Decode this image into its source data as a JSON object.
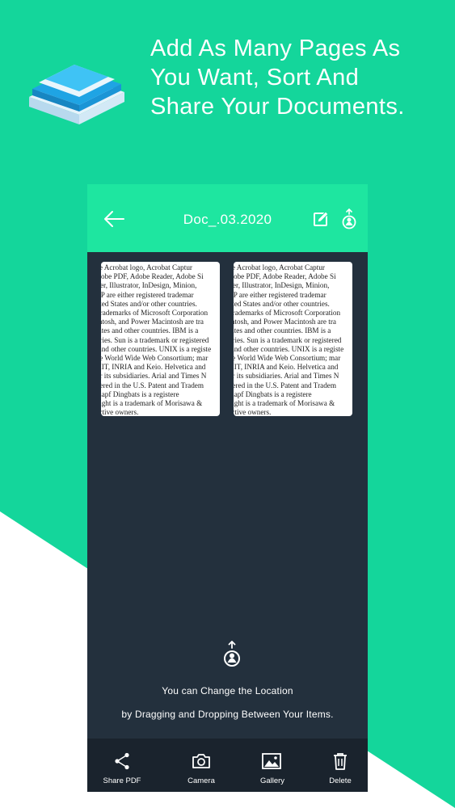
{
  "promo": {
    "headline_lines": [
      "Add As Many Pages As",
      "You Want, Sort And",
      "Share Your Documents."
    ]
  },
  "app_bar": {
    "title": "Doc_.03.2020"
  },
  "pages": [
    {
      "lines": [
        "gs, the Acrobat logo, Acrobat Captur",
        "el, Adobe PDF, Adobe Reader, Adobe Si",
        "eMaker, Illustrator, InDesign, Minion,",
        "d XMP are either registered trademar",
        "e United States and/or other countries.",
        "ered trademarks of Microsoft Corporation",
        "Macintosh, and Power Macintosh are tra",
        "ed States and other countries. IBM is a",
        "countries. Sun is a trademark or registered",
        "U.S. and other countries. UNIX is a registe",
        "for the World Wide Web Consortium; mar",
        "ans MIT, INRIA and Keio. Helvetica and",
        "and/or its subsidiaries. Arial and Times N",
        "registered in the U.S. Patent and Tradem",
        "ITC Zapf Dingbats is a registere",
        "ryo Light is a trademark of Morisawa &",
        "respective owners."
      ]
    },
    {
      "lines": [
        "gs, the Acrobat logo, Acrobat Captur",
        "el, Adobe PDF, Adobe Reader, Adobe Si",
        "eMaker, Illustrator, InDesign, Minion,",
        "d XMP are either registered trademar",
        "e United States and/or other countries.",
        "ered trademarks of Microsoft Corporation",
        "Macintosh, and Power Macintosh are tra",
        "ed States and other countries. IBM is a",
        "countries. Sun is a trademark or registered",
        "U.S. and other countries. UNIX is a registe",
        "for the World Wide Web Consortium; mar",
        "ans MIT, INRIA and Keio. Helvetica and",
        "and/or its subsidiaries. Arial and Times N",
        "registered in the U.S. Patent and Tradem",
        "ITC Zapf Dingbats is a registere",
        "ryo Light is a trademark of Morisawa &",
        "respective owners."
      ]
    }
  ],
  "hint": {
    "line1": "You can Change the Location",
    "line2": "by Dragging and Dropping Between Your Items."
  },
  "bottom_bar": {
    "share_label": "Share PDF",
    "camera_label": "Camera",
    "gallery_label": "Gallery",
    "delete_label": "Delete"
  },
  "colors": {
    "background": "#14d69b",
    "app_bar": "#1ee6a0",
    "content_bg": "#23303d",
    "bottom_bar": "#1a232d"
  }
}
